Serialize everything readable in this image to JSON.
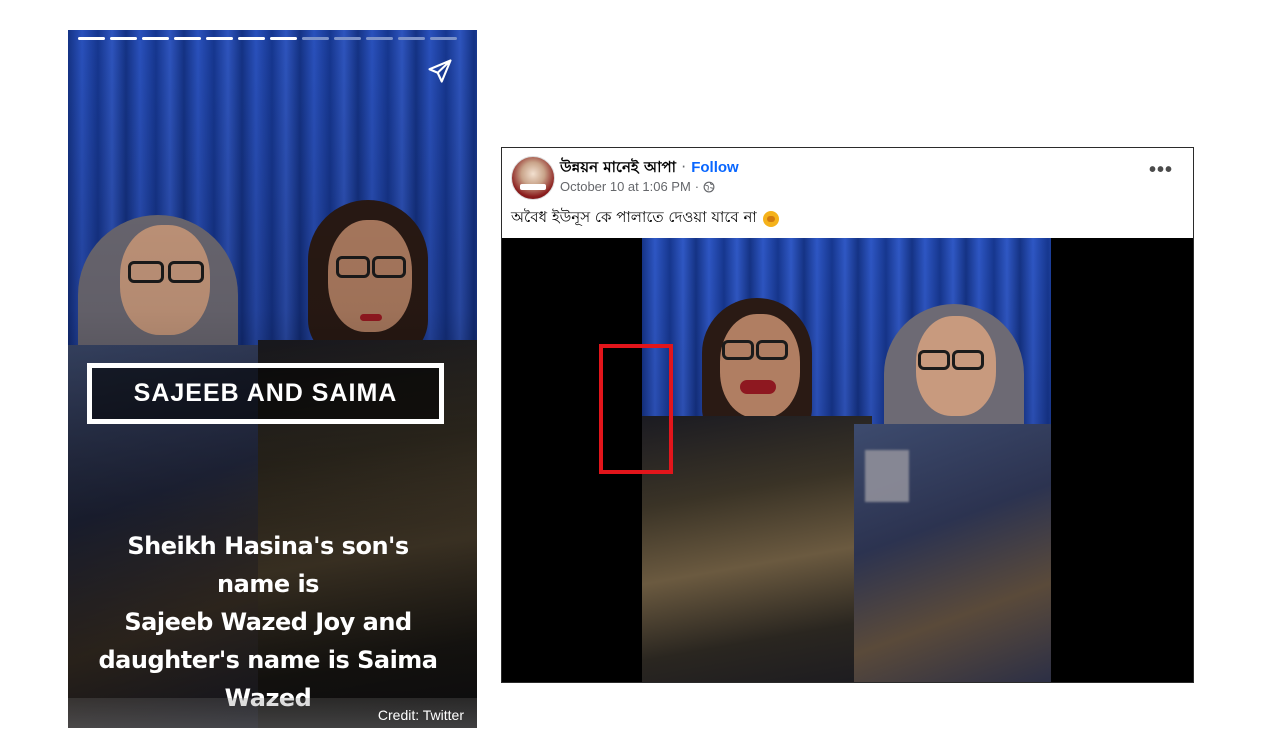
{
  "story": {
    "progress": {
      "total_segments": 12,
      "completed_segments": 7
    },
    "title": "SAJEEB AND SAIMA",
    "caption_lines": [
      "Sheikh Hasina's son's name is",
      "Sajeeb Wazed Joy and",
      "daughter's name is Saima",
      "Wazed"
    ],
    "credit": "Credit: Twitter",
    "icons": {
      "share": "send-icon"
    }
  },
  "post": {
    "page_name": "উন্নয়ন মানেই আপা",
    "separator": "·",
    "follow_label": "Follow",
    "timestamp": "October 10 at 1:06 PM",
    "meta_separator": "·",
    "text": "অবৈধ ইউনূস কে পালাতে দেওয়া যাবে না",
    "more_label": "•••",
    "icons": {
      "privacy": "globe-icon",
      "reaction": "fist-emoji-icon",
      "more": "more-options-icon"
    }
  },
  "colors": {
    "follow_link": "#0866ff",
    "highlight_box": "#e2151b",
    "progress_done": "#ffffff",
    "progress_pending": "#7d93c9"
  }
}
